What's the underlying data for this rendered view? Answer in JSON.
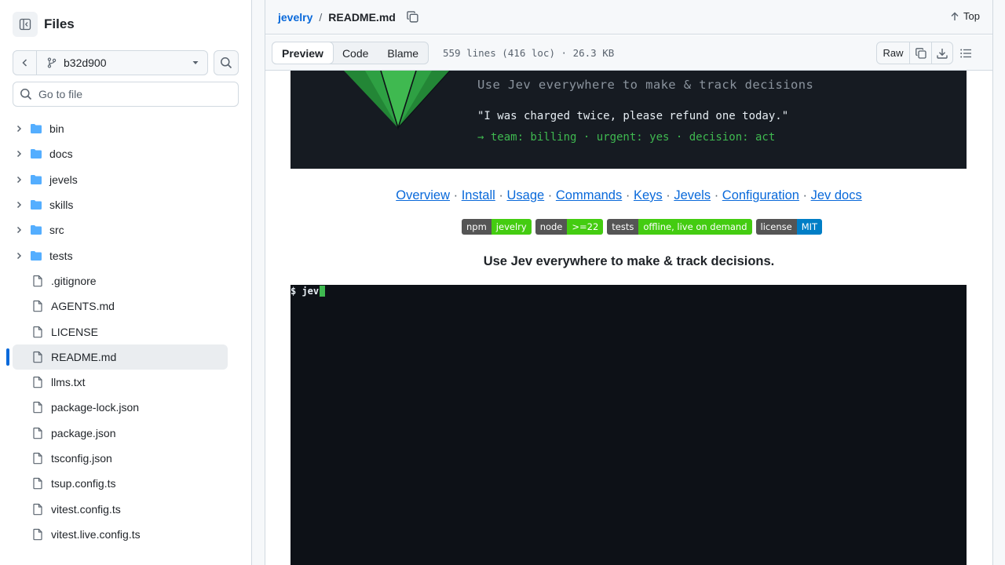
{
  "sidebar": {
    "title": "Files",
    "branch": "b32d900",
    "goto_placeholder": "Go to file",
    "folders": [
      "bin",
      "docs",
      "jevels",
      "skills",
      "src",
      "tests"
    ],
    "files": [
      ".gitignore",
      "AGENTS.md",
      "LICENSE",
      "README.md",
      "llms.txt",
      "package-lock.json",
      "package.json",
      "tsconfig.json",
      "tsup.config.ts",
      "vitest.config.ts",
      "vitest.live.config.ts"
    ],
    "active_file": "README.md"
  },
  "breadcrumb": {
    "repo": "jevelry",
    "sep": "/",
    "file": "README.md"
  },
  "top_label": "Top",
  "tabs": {
    "preview": "Preview",
    "code": "Code",
    "blame": "Blame"
  },
  "file_info": "559 lines (416 loc) · 26.3 KB",
  "actions": {
    "raw": "Raw"
  },
  "readme": {
    "hero": {
      "tagline": "Use Jev everywhere to make & track decisions",
      "quote": "\"I was charged twice, please refund one today.\"",
      "route": "→ team: billing · urgent: yes · decision: act"
    },
    "nav_links": [
      "Overview",
      "Install",
      "Usage",
      "Commands",
      "Keys",
      "Jevels",
      "Configuration",
      "Jev docs"
    ],
    "nav_sep": "·",
    "badges": [
      {
        "label": "npm",
        "value": "jevelry",
        "color": "#4c1"
      },
      {
        "label": "node",
        "value": ">=22",
        "color": "#4c1"
      },
      {
        "label": "tests",
        "value": "offline, live on demand",
        "color": "#4c1"
      },
      {
        "label": "license",
        "value": "MIT",
        "color": "#007ec6"
      }
    ],
    "tagline": "Use Jev everywhere to make & track decisions.",
    "terminal_prompt": "$ jev"
  }
}
